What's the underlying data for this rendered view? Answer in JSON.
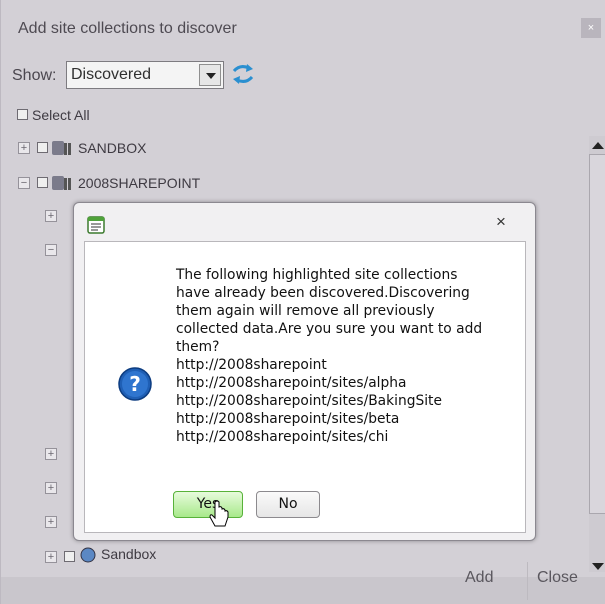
{
  "window": {
    "title": "Add site collections to discover",
    "close_label": "×"
  },
  "filter": {
    "show_label": "Show:",
    "selected": "Discovered"
  },
  "select_all_label": "Select All",
  "tree": [
    {
      "label": "SANDBOX",
      "expander": "+"
    },
    {
      "label": "2008SHAREPOINT",
      "expander": "−"
    },
    {
      "label": "Sandbox",
      "expander": "+"
    }
  ],
  "footer": {
    "add_label": "Add",
    "close_label": "Close"
  },
  "dialog": {
    "close_label": "×",
    "message_lines": [
      "The following highlighted site collections",
      "have already been discovered.Discovering",
      "them again will remove all previously",
      "collected data.Are you sure you want to add",
      "them?",
      "http://2008sharepoint",
      "http://2008sharepoint/sites/alpha",
      "http://2008sharepoint/sites/BakingSite",
      "http://2008sharepoint/sites/beta",
      "http://2008sharepoint/sites/chi"
    ],
    "yes_label": "Yes",
    "no_label": "No"
  },
  "colors": {
    "panel_bg": "#d3d0d6",
    "yes_accent": "#a8e98b",
    "question_icon": "#1f5fb5"
  }
}
